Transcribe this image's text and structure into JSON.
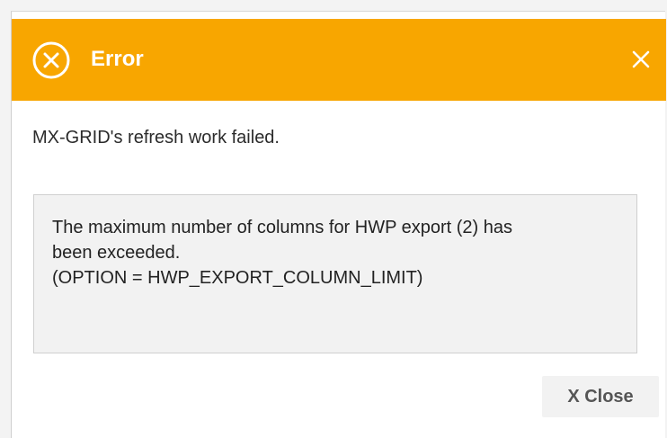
{
  "dialog": {
    "title": "Error",
    "icon": "error-circle-x-icon",
    "close_icon": "close-icon",
    "message": "MX-GRID's refresh work failed.",
    "detail_lines": [
      "The maximum number of columns for HWP export (2) has",
      "been exceeded.",
      "(OPTION = HWP_EXPORT_COLUMN_LIMIT)"
    ],
    "close_button_label": "X Close"
  },
  "colors": {
    "header": "#f8a600",
    "header_text": "#ffffff",
    "detail_background": "#f2f2f2",
    "button_text": "#555555"
  }
}
